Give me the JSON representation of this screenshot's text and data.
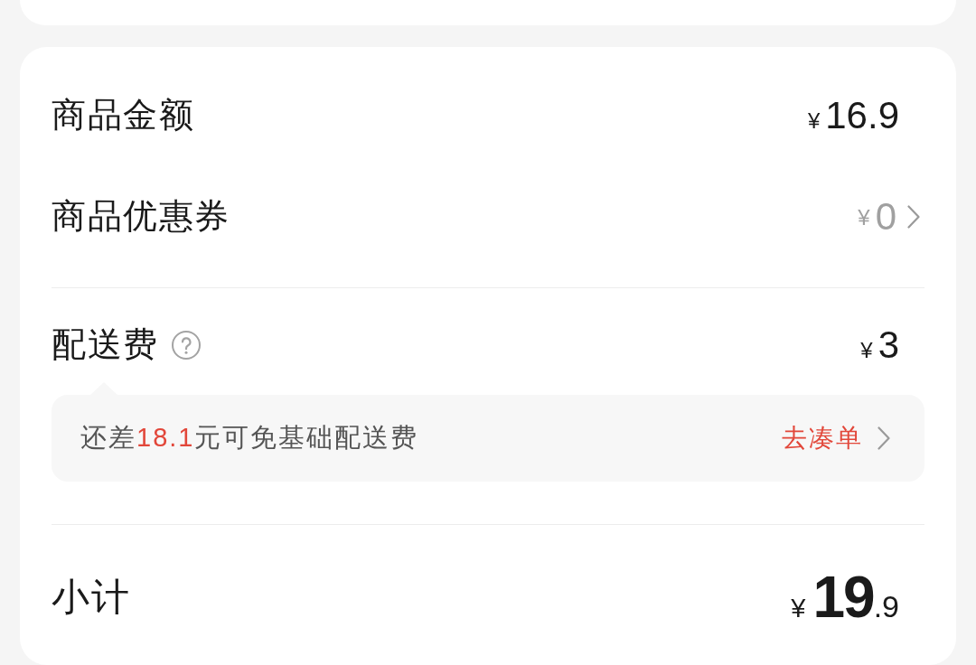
{
  "order_summary": {
    "sections": [
      {
        "rows": [
          {
            "kind": "amount",
            "label": "商品金额",
            "currency": "¥",
            "amount": "16.9",
            "muted": false,
            "arrow": false
          },
          {
            "kind": "amount",
            "label": "商品优惠券",
            "currency": "¥",
            "amount": "0",
            "muted": true,
            "arrow": true
          }
        ]
      },
      {
        "rows": [
          {
            "kind": "fee",
            "label": "配送费",
            "currency": "¥",
            "amount": "3",
            "muted": false,
            "arrow": false,
            "tip": {
              "parts": [
                {
                  "text": "还差",
                  "highlight": false
                },
                {
                  "text": "18.1",
                  "highlight": true
                },
                {
                  "text": "元可免基础配送费",
                  "highlight": false
                }
              ],
              "action": "去凑单"
            }
          }
        ]
      },
      {
        "rows": [
          {
            "kind": "total",
            "label": "小计",
            "currency": "¥",
            "amount": "19",
            "decimal": ".9"
          }
        ]
      }
    ]
  }
}
